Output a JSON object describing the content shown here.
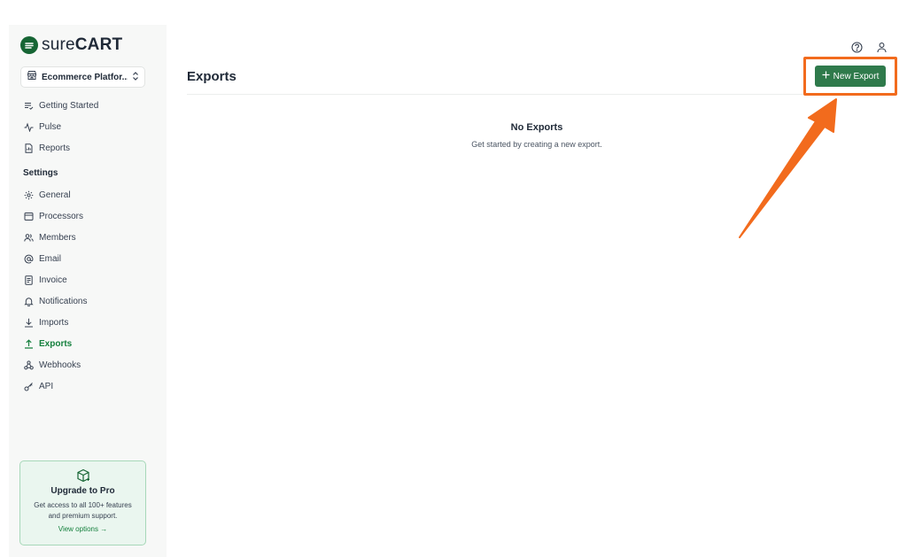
{
  "brand": {
    "name_light": "sure",
    "name_bold": "CART"
  },
  "store": {
    "name": "Ecommerce Platfor..."
  },
  "nav_primary": [
    {
      "label": "Getting Started",
      "icon": "list-check-icon"
    },
    {
      "label": "Pulse",
      "icon": "activity-icon"
    },
    {
      "label": "Reports",
      "icon": "report-icon"
    }
  ],
  "settings_heading": "Settings",
  "nav_settings": [
    {
      "label": "General",
      "icon": "gear-icon"
    },
    {
      "label": "Processors",
      "icon": "processor-icon"
    },
    {
      "label": "Members",
      "icon": "users-icon"
    },
    {
      "label": "Email",
      "icon": "at-icon"
    },
    {
      "label": "Invoice",
      "icon": "invoice-icon"
    },
    {
      "label": "Notifications",
      "icon": "bell-icon"
    },
    {
      "label": "Imports",
      "icon": "download-icon"
    },
    {
      "label": "Exports",
      "icon": "upload-icon",
      "active": true
    },
    {
      "label": "Webhooks",
      "icon": "webhook-icon"
    },
    {
      "label": "API",
      "icon": "key-icon"
    }
  ],
  "upgrade": {
    "title": "Upgrade to Pro",
    "description": "Get access to all 100+ features and premium support.",
    "link": "View options"
  },
  "page": {
    "title": "Exports",
    "new_button": "New Export",
    "empty_title": "No Exports",
    "empty_subtitle": "Get started by creating a new export."
  },
  "colors": {
    "accent": "#15803d",
    "button": "#2f7a4b",
    "annotation": "#f26b1d"
  }
}
